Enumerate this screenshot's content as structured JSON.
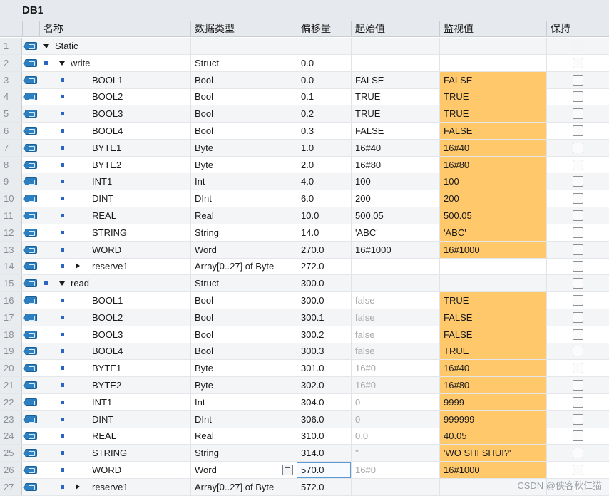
{
  "title": "DB1",
  "headers": {
    "name": "名称",
    "dtype": "数据类型",
    "offset": "偏移量",
    "start": "起始值",
    "monitor": "监视值",
    "retain": "保持"
  },
  "rows": [
    {
      "num": "1",
      "level": 0,
      "toggle": "down",
      "square": false,
      "name": "Static",
      "dtype": "",
      "offset": "",
      "start": "",
      "monitor": "",
      "start_gray": false,
      "mon_hl": false,
      "retain_dim": true
    },
    {
      "num": "2",
      "level": 1,
      "toggle": "down",
      "square": true,
      "name": "write",
      "dtype": "Struct",
      "offset": "0.0",
      "start": "",
      "monitor": "",
      "start_gray": false,
      "mon_hl": false,
      "retain_dim": false
    },
    {
      "num": "3",
      "level": 2,
      "toggle": "",
      "square": true,
      "name": "BOOL1",
      "dtype": "Bool",
      "offset": "0.0",
      "start": "FALSE",
      "monitor": "FALSE",
      "start_gray": false,
      "mon_hl": true,
      "retain_dim": false
    },
    {
      "num": "4",
      "level": 2,
      "toggle": "",
      "square": true,
      "name": "BOOL2",
      "dtype": "Bool",
      "offset": "0.1",
      "start": "TRUE",
      "monitor": "TRUE",
      "start_gray": false,
      "mon_hl": true,
      "retain_dim": false
    },
    {
      "num": "5",
      "level": 2,
      "toggle": "",
      "square": true,
      "name": "BOOL3",
      "dtype": "Bool",
      "offset": "0.2",
      "start": "TRUE",
      "monitor": "TRUE",
      "start_gray": false,
      "mon_hl": true,
      "retain_dim": false
    },
    {
      "num": "6",
      "level": 2,
      "toggle": "",
      "square": true,
      "name": "BOOL4",
      "dtype": "Bool",
      "offset": "0.3",
      "start": "FALSE",
      "monitor": "FALSE",
      "start_gray": false,
      "mon_hl": true,
      "retain_dim": false
    },
    {
      "num": "7",
      "level": 2,
      "toggle": "",
      "square": true,
      "name": "BYTE1",
      "dtype": "Byte",
      "offset": "1.0",
      "start": "16#40",
      "monitor": "16#40",
      "start_gray": false,
      "mon_hl": true,
      "retain_dim": false
    },
    {
      "num": "8",
      "level": 2,
      "toggle": "",
      "square": true,
      "name": "BYTE2",
      "dtype": "Byte",
      "offset": "2.0",
      "start": "16#80",
      "monitor": "16#80",
      "start_gray": false,
      "mon_hl": true,
      "retain_dim": false
    },
    {
      "num": "9",
      "level": 2,
      "toggle": "",
      "square": true,
      "name": "INT1",
      "dtype": "Int",
      "offset": "4.0",
      "start": "100",
      "monitor": "100",
      "start_gray": false,
      "mon_hl": true,
      "retain_dim": false
    },
    {
      "num": "10",
      "level": 2,
      "toggle": "",
      "square": true,
      "name": "DINT",
      "dtype": "DInt",
      "offset": "6.0",
      "start": "200",
      "monitor": "200",
      "start_gray": false,
      "mon_hl": true,
      "retain_dim": false
    },
    {
      "num": "11",
      "level": 2,
      "toggle": "",
      "square": true,
      "name": "REAL",
      "dtype": "Real",
      "offset": "10.0",
      "start": "500.05",
      "monitor": "500.05",
      "start_gray": false,
      "mon_hl": true,
      "retain_dim": false
    },
    {
      "num": "12",
      "level": 2,
      "toggle": "",
      "square": true,
      "name": "STRING",
      "dtype": "String",
      "offset": "14.0",
      "start": "'ABC'",
      "monitor": "'ABC'",
      "start_gray": false,
      "mon_hl": true,
      "retain_dim": false
    },
    {
      "num": "13",
      "level": 2,
      "toggle": "",
      "square": true,
      "name": "WORD",
      "dtype": "Word",
      "offset": "270.0",
      "start": "16#1000",
      "monitor": "16#1000",
      "start_gray": false,
      "mon_hl": true,
      "retain_dim": false
    },
    {
      "num": "14",
      "level": 2,
      "toggle": "right",
      "square": true,
      "name": "reserve1",
      "dtype": "Array[0..27] of Byte",
      "offset": "272.0",
      "start": "",
      "monitor": "",
      "start_gray": false,
      "mon_hl": false,
      "retain_dim": false
    },
    {
      "num": "15",
      "level": 1,
      "toggle": "down",
      "square": true,
      "name": "read",
      "dtype": "Struct",
      "offset": "300.0",
      "start": "",
      "monitor": "",
      "start_gray": false,
      "mon_hl": false,
      "retain_dim": false
    },
    {
      "num": "16",
      "level": 2,
      "toggle": "",
      "square": true,
      "name": "BOOL1",
      "dtype": "Bool",
      "offset": "300.0",
      "start": "false",
      "monitor": "TRUE",
      "start_gray": true,
      "mon_hl": true,
      "retain_dim": false
    },
    {
      "num": "17",
      "level": 2,
      "toggle": "",
      "square": true,
      "name": "BOOL2",
      "dtype": "Bool",
      "offset": "300.1",
      "start": "false",
      "monitor": "FALSE",
      "start_gray": true,
      "mon_hl": true,
      "retain_dim": false
    },
    {
      "num": "18",
      "level": 2,
      "toggle": "",
      "square": true,
      "name": "BOOL3",
      "dtype": "Bool",
      "offset": "300.2",
      "start": "false",
      "monitor": "FALSE",
      "start_gray": true,
      "mon_hl": true,
      "retain_dim": false
    },
    {
      "num": "19",
      "level": 2,
      "toggle": "",
      "square": true,
      "name": "BOOL4",
      "dtype": "Bool",
      "offset": "300.3",
      "start": "false",
      "monitor": "TRUE",
      "start_gray": true,
      "mon_hl": true,
      "retain_dim": false
    },
    {
      "num": "20",
      "level": 2,
      "toggle": "",
      "square": true,
      "name": "BYTE1",
      "dtype": "Byte",
      "offset": "301.0",
      "start": "16#0",
      "monitor": "16#40",
      "start_gray": true,
      "mon_hl": true,
      "retain_dim": false
    },
    {
      "num": "21",
      "level": 2,
      "toggle": "",
      "square": true,
      "name": "BYTE2",
      "dtype": "Byte",
      "offset": "302.0",
      "start": "16#0",
      "monitor": "16#80",
      "start_gray": true,
      "mon_hl": true,
      "retain_dim": false
    },
    {
      "num": "22",
      "level": 2,
      "toggle": "",
      "square": true,
      "name": "INT1",
      "dtype": "Int",
      "offset": "304.0",
      "start": "0",
      "monitor": "9999",
      "start_gray": true,
      "mon_hl": true,
      "retain_dim": false
    },
    {
      "num": "23",
      "level": 2,
      "toggle": "",
      "square": true,
      "name": "DINT",
      "dtype": "DInt",
      "offset": "306.0",
      "start": "0",
      "monitor": "999999",
      "start_gray": true,
      "mon_hl": true,
      "retain_dim": false
    },
    {
      "num": "24",
      "level": 2,
      "toggle": "",
      "square": true,
      "name": "REAL",
      "dtype": "Real",
      "offset": "310.0",
      "start": "0.0",
      "monitor": "40.05",
      "start_gray": true,
      "mon_hl": true,
      "retain_dim": false
    },
    {
      "num": "25",
      "level": 2,
      "toggle": "",
      "square": true,
      "name": "STRING",
      "dtype": "String",
      "offset": "314.0",
      "start": "''",
      "monitor": "'WO SHI SHUI?'",
      "start_gray": true,
      "mon_hl": true,
      "retain_dim": false
    },
    {
      "num": "26",
      "level": 2,
      "toggle": "",
      "square": true,
      "name": "WORD",
      "dtype": "Word",
      "offset": "570.0",
      "start": "16#0",
      "monitor": "16#1000",
      "start_gray": true,
      "mon_hl": true,
      "retain_dim": false,
      "selected": true
    },
    {
      "num": "27",
      "level": 2,
      "toggle": "right",
      "square": true,
      "name": "reserve1",
      "dtype": "Array[0..27] of Byte",
      "offset": "572.0",
      "start": "",
      "monitor": "",
      "start_gray": false,
      "mon_hl": false,
      "retain_dim": false
    }
  ],
  "watermark": "CSDN @侠客秋仁猫"
}
